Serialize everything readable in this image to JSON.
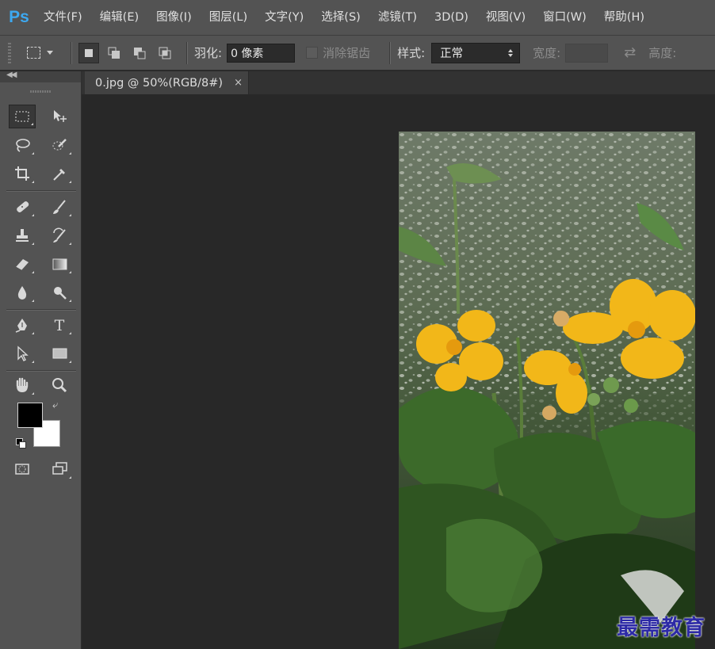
{
  "app": {
    "logo": "Ps"
  },
  "menu": [
    "文件(F)",
    "编辑(E)",
    "图像(I)",
    "图层(L)",
    "文字(Y)",
    "选择(S)",
    "滤镜(T)",
    "3D(D)",
    "视图(V)",
    "窗口(W)",
    "帮助(H)"
  ],
  "options": {
    "feather_label": "羽化:",
    "feather_value": "0 像素",
    "antialias_label": "消除锯齿",
    "style_label": "样式:",
    "style_value": "正常",
    "width_label": "宽度:",
    "height_label": "高度:"
  },
  "document": {
    "tab_title": "0.jpg @ 50%(RGB/8#)",
    "close_symbol": "×"
  },
  "colors": {
    "foreground": "#000000",
    "background": "#ffffff"
  },
  "watermark": "最需教育"
}
